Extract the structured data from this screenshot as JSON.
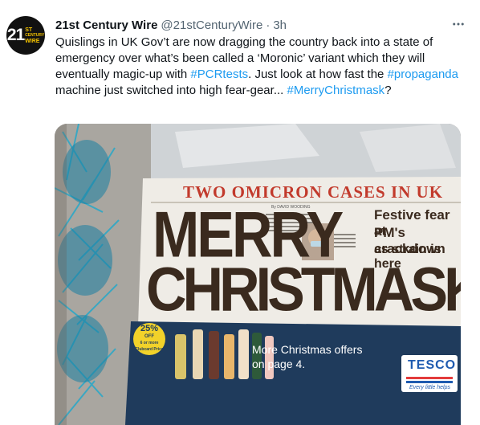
{
  "tweet": {
    "author_name": "21st Century Wire",
    "handle": "@21stCenturyWire",
    "separator": "·",
    "time": "3h",
    "avatar": {
      "number": "21",
      "line1": "ST",
      "line2": "CENTURY",
      "line3": "WIRE"
    },
    "text_parts": [
      "Quislings in UK Gov’t are now dragging the country back into a state of emergency over what’s been called a ‘Moronic’ variant which they will eventually magic-up with ",
      "#PCRtests",
      ". Just look at how fast the ",
      "#propaganda",
      " machine just switched into high fear-gear... ",
      "#MerryChristmask",
      "?"
    ]
  },
  "newspaper": {
    "top_headline": "TWO OMICRON CASES IN UK",
    "main_headline_1": "MERRY",
    "main_headline_2": "CHRISTMASK",
    "byline": "By DAVID WOODING",
    "subhead_1": "Festive fear at",
    "subhead_2": "PM's crackdown",
    "subhead_3": "as strain is here",
    "offer_badge_1": "25%",
    "offer_badge_2": "OFF",
    "offer_badge_3": "6 or more",
    "offer_badge_4": "Clubcard Price",
    "ad_text_1": "More Christmas offers",
    "ad_text_2": "on page 4.",
    "tesco_logo": "TESCO",
    "tesco_tagline": "Every little helps"
  },
  "colors": {
    "link": "#1d9bf0",
    "text": "#0f1419",
    "muted": "#536471",
    "headline_red": "#c23a2c",
    "headline_dark": "#3a2a1e",
    "ad_bg": "#1f3b5c",
    "tinsel": "#2ea8c6"
  },
  "icons": {
    "more": "more-horizontal-icon"
  }
}
